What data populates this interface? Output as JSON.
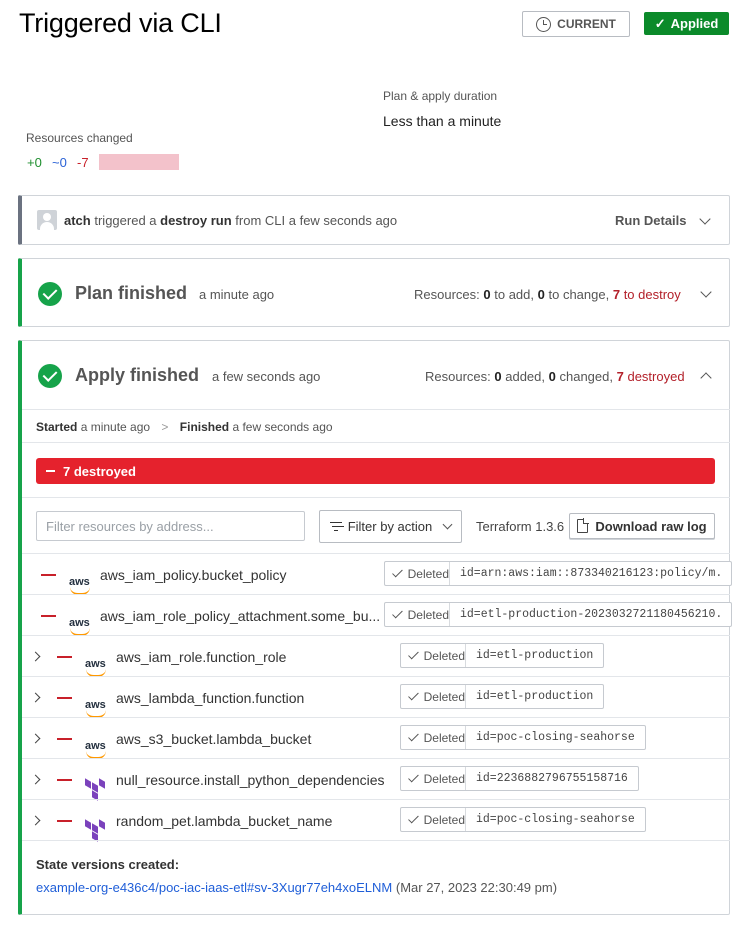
{
  "header": {
    "title": "Triggered via CLI",
    "current_label": "CURRENT",
    "status_badge": "Applied"
  },
  "meta": {
    "duration_label": "Plan & apply duration",
    "duration_value": "Less than a minute",
    "resources_changed_label": "Resources changed",
    "added": "+0",
    "changed": "~0",
    "destroyed": "-7"
  },
  "run": {
    "user": "atch",
    "text_triggered": "triggered a",
    "run_type": "destroy run",
    "text_from": "from CLI a few seconds ago",
    "details_label": "Run Details"
  },
  "plan": {
    "title": "Plan finished",
    "time": "a minute ago",
    "summary_prefix": "Resources:",
    "add_count": "0",
    "add_text": "to add,",
    "change_count": "0",
    "change_text": "to change,",
    "destroy_count": "7",
    "destroy_text": "to destroy"
  },
  "apply": {
    "title": "Apply finished",
    "time": "a few seconds ago",
    "summary_prefix": "Resources:",
    "added_count": "0",
    "added_text": "added,",
    "changed_count": "0",
    "changed_text": "changed,",
    "destroyed_count": "7",
    "destroyed_text": "destroyed",
    "started_label": "Started",
    "started_time": "a minute ago",
    "finished_label": "Finished",
    "finished_time": "a few seconds ago",
    "destroyed_bar": "7 destroyed",
    "filter_placeholder": "Filter resources by address...",
    "filter_action_label": "Filter by action",
    "terraform_version": "Terraform 1.3.6",
    "download_label": "Download raw log"
  },
  "resources": [
    {
      "name": "aws_iam_policy.bucket_policy",
      "provider": "aws",
      "status": "Deleted",
      "id": "id=arn:aws:iam::873340216123:policy/m.",
      "expandable": false
    },
    {
      "name": "aws_iam_role_policy_attachment.some_bu...",
      "provider": "aws",
      "status": "Deleted",
      "id": "id=etl-production-2023032721180456210.",
      "expandable": false
    },
    {
      "name": "aws_iam_role.function_role",
      "provider": "aws",
      "status": "Deleted",
      "id": "id=etl-production",
      "expandable": true
    },
    {
      "name": "aws_lambda_function.function",
      "provider": "aws",
      "status": "Deleted",
      "id": "id=etl-production",
      "expandable": true
    },
    {
      "name": "aws_s3_bucket.lambda_bucket",
      "provider": "aws",
      "status": "Deleted",
      "id": "id=poc-closing-seahorse",
      "expandable": true
    },
    {
      "name": "null_resource.install_python_dependencies",
      "provider": "terraform",
      "status": "Deleted",
      "id": "id=2236882796755158716",
      "expandable": true
    },
    {
      "name": "random_pet.lambda_bucket_name",
      "provider": "terraform",
      "status": "Deleted",
      "id": "id=poc-closing-seahorse",
      "expandable": true
    }
  ],
  "state": {
    "title": "State versions created:",
    "link": "example-org-e436c4/poc-iac-iaas-etl#sv-3Xugr77eh4xoELNM",
    "timestamp": "(Mar 27, 2023 22:30:49 pm)"
  },
  "colors": {
    "applied_green": "#0b8a2a",
    "destroyed_red": "#e5222d",
    "link_blue": "#1f5ed8"
  }
}
